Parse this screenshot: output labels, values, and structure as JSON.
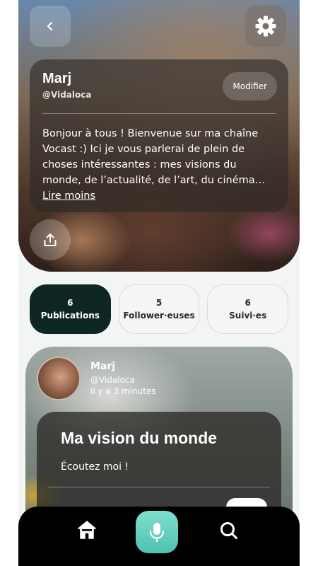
{
  "profile": {
    "name": "Marj",
    "handle": "@Vidaloca",
    "edit_label": "Modifier",
    "bio": "Bonjour à tous ! Bienvenue sur ma chaîne Vocast :) Ici je vous parlerai de plein de choses intéressantes : mes visions du monde, de l’actualité, de l’art, du cinéma… ",
    "bio_toggle": "Lire moins"
  },
  "stats": [
    {
      "count": "6",
      "label": "Publications",
      "active": true
    },
    {
      "count": "5",
      "label": "Follower·euses",
      "active": false
    },
    {
      "count": "6",
      "label": "Suivi·es",
      "active": false
    }
  ],
  "post": {
    "author_name": "Marj",
    "author_handle": "@Vidaloca",
    "time": "il y a 3 minutes",
    "title": "Ma vision du monde",
    "subtitle": "Écoutez moi !"
  },
  "icons": {
    "back": "chevron-left-icon",
    "settings": "gear-icon",
    "share": "share-icon",
    "home": "home-icon",
    "mic": "microphone-icon",
    "search": "search-icon"
  },
  "colors": {
    "accent": "#5fd0bd",
    "active_tab": "#0e2624",
    "nav_bg": "#000000"
  }
}
